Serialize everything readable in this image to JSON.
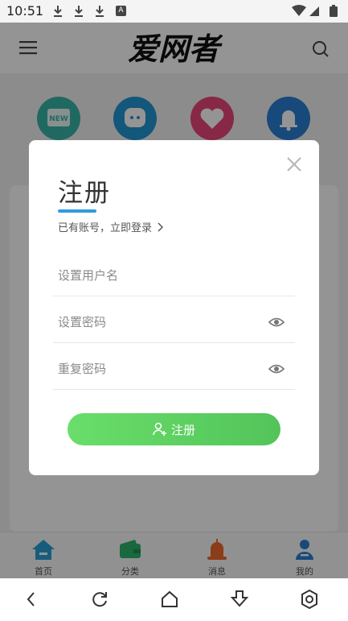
{
  "status_bar": {
    "time": "10:51",
    "notification_icon_letter": "A"
  },
  "header": {
    "logo_text": "爱网者"
  },
  "quick_icons": [
    {
      "name": "new-icon",
      "badge": "NEW",
      "color": "#38b6a8"
    },
    {
      "name": "chat-bubble-icon",
      "color": "#2196d3"
    },
    {
      "name": "heart-icon",
      "color": "#e8457a"
    },
    {
      "name": "bell-icon",
      "color": "#2a7fd4"
    }
  ],
  "modal": {
    "title": "注册",
    "login_link": "已有账号，立即登录",
    "fields": {
      "username_placeholder": "设置用户名",
      "password_placeholder": "设置密码",
      "confirm_placeholder": "重复密码"
    },
    "submit_label": "注册"
  },
  "tabs": [
    {
      "label": "首页",
      "icon": "home-icon",
      "color": "#2a9fd6"
    },
    {
      "label": "分类",
      "icon": "wallet-icon",
      "color": "#2db36a"
    },
    {
      "label": "消息",
      "icon": "alarm-icon",
      "color": "#ef6a2b"
    },
    {
      "label": "我的",
      "icon": "person-icon",
      "color": "#2a7fd4"
    }
  ],
  "colors": {
    "accent": "#2f9be0",
    "button_start": "#6ade6a",
    "button_end": "#52c45a"
  }
}
